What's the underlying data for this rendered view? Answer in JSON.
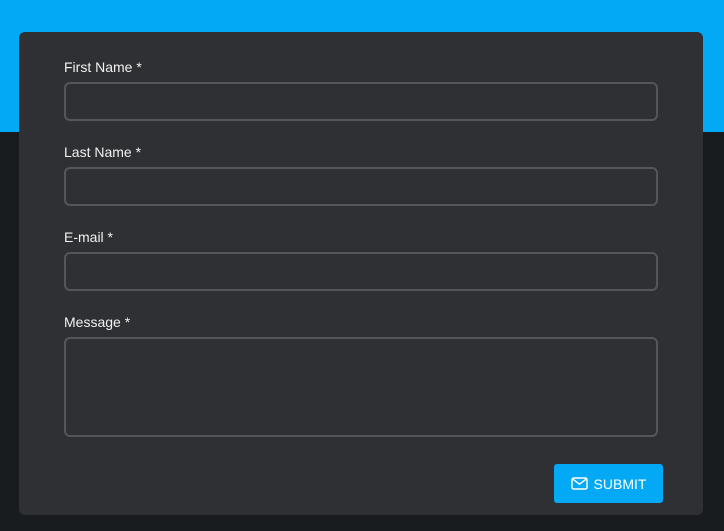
{
  "form": {
    "fields": [
      {
        "label": "First Name *",
        "value": ""
      },
      {
        "label": "Last Name *",
        "value": ""
      },
      {
        "label": "E-mail *",
        "value": ""
      },
      {
        "label": "Message *",
        "value": ""
      }
    ],
    "submit_label": "SUBMIT",
    "submit_icon": "envelope-icon"
  },
  "colors": {
    "accent": "#03a9f4",
    "background": "#191c1e",
    "card": "#2f3033",
    "input_border": "#55565a",
    "text": "#f1f1f1"
  }
}
